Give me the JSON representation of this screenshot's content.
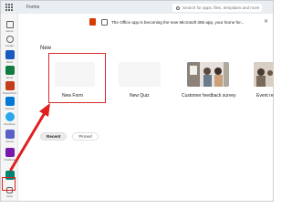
{
  "header": {
    "app_title": "Forms",
    "search_placeholder": "Search for apps, files, templates and more"
  },
  "sidebar": {
    "items": [
      {
        "name": "home",
        "label": "Home"
      },
      {
        "name": "create",
        "label": "Create"
      },
      {
        "name": "word",
        "label": "Word"
      },
      {
        "name": "excel",
        "label": "Excel"
      },
      {
        "name": "powerpoint",
        "label": "PowerPoint"
      },
      {
        "name": "outlook",
        "label": "Outlook"
      },
      {
        "name": "onedrive",
        "label": "OneDrive"
      },
      {
        "name": "teams",
        "label": "Teams"
      },
      {
        "name": "onenote",
        "label": "OneNote"
      },
      {
        "name": "forms",
        "label": ""
      },
      {
        "name": "apps",
        "label": "Apps"
      }
    ]
  },
  "banner": {
    "text": "The Office app is becoming the new Microsoft 365 app, your home for..."
  },
  "new_section": {
    "heading": "New",
    "tiles": [
      {
        "label": "New Form"
      },
      {
        "label": "New Quiz"
      },
      {
        "label": "Customer feedback survey"
      },
      {
        "label": "Event re"
      }
    ]
  },
  "tabs": [
    {
      "label": "Recent",
      "active": true
    },
    {
      "label": "Pinned",
      "active": false
    }
  ],
  "colors": {
    "annotation_red": "#e02020",
    "forms_green": "#008272"
  }
}
